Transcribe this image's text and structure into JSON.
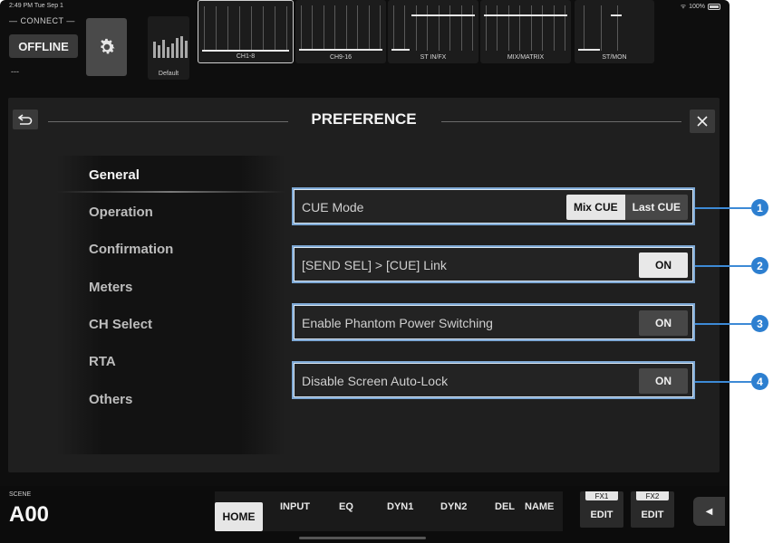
{
  "status_bar": {
    "time": "2:49 PM  Tue Sep 1",
    "battery": "100%"
  },
  "header": {
    "connect_label": "— CONNECT —",
    "offline_label": "OFFLINE",
    "connection_detail": "---",
    "scene_default_label": "Default",
    "fader_groups": [
      {
        "label": "CH1-8",
        "selected": true
      },
      {
        "label": "CH9-16",
        "selected": false
      },
      {
        "label": "ST IN/FX",
        "selected": false
      },
      {
        "label": "MIX/MATRIX",
        "selected": false
      },
      {
        "label": "ST/MON",
        "selected": false
      }
    ]
  },
  "panel": {
    "title": "PREFERENCE",
    "sidebar": [
      {
        "label": "General",
        "active": true
      },
      {
        "label": "Operation",
        "active": false
      },
      {
        "label": "Confirmation",
        "active": false
      },
      {
        "label": "Meters",
        "active": false
      },
      {
        "label": "CH Select",
        "active": false
      },
      {
        "label": "RTA",
        "active": false
      },
      {
        "label": "Others",
        "active": false
      }
    ],
    "options": [
      {
        "label": "CUE Mode",
        "type": "segmented",
        "choices": [
          "Mix CUE",
          "Last CUE"
        ],
        "selected": "Mix CUE",
        "callout": "1"
      },
      {
        "label": "[SEND SEL] > [CUE] Link",
        "type": "toggle",
        "value": "ON",
        "state": "on",
        "callout": "2"
      },
      {
        "label": "Enable Phantom Power Switching",
        "type": "toggle",
        "value": "ON",
        "state": "off",
        "callout": "3"
      },
      {
        "label": "Disable Screen Auto-Lock",
        "type": "toggle",
        "value": "ON",
        "state": "off",
        "callout": "4"
      }
    ]
  },
  "bottom": {
    "scene_label": "SCENE",
    "scene_number": "A00",
    "tabs": [
      "HOME",
      "INPUT",
      "EQ",
      "DYN1",
      "DYN2",
      "DEL",
      "NAME"
    ],
    "fx": [
      {
        "title": "FX1",
        "edit": "EDIT"
      },
      {
        "title": "FX2",
        "edit": "EDIT"
      }
    ],
    "expand_icon": "left-triangle-icon"
  },
  "colors": {
    "callout_blue": "#2d7fd0",
    "highlight_border": "#7ea9d6"
  }
}
